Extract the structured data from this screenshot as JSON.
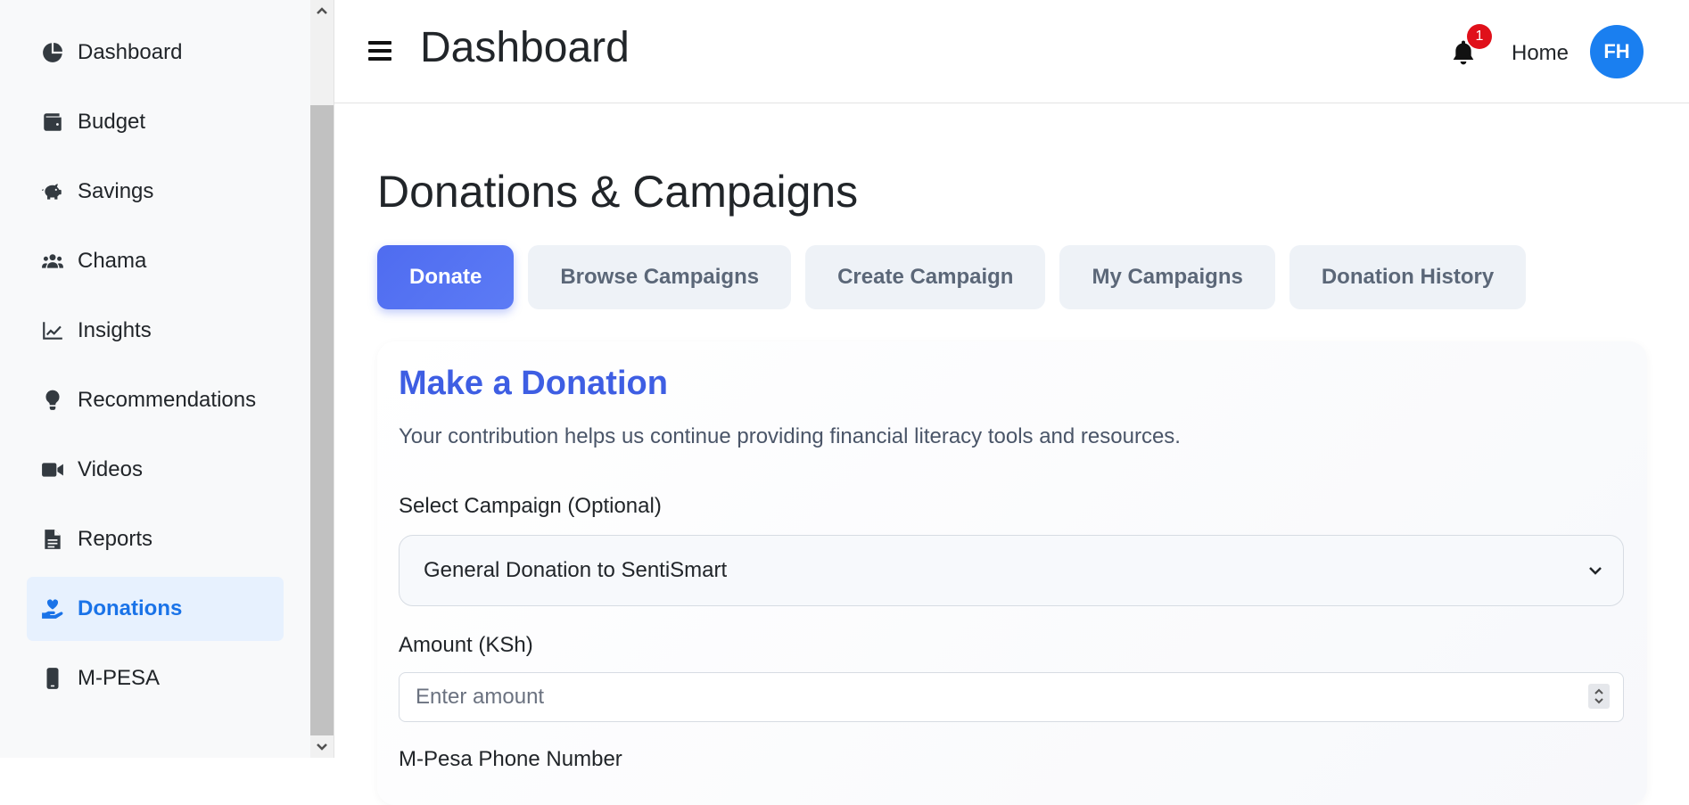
{
  "sidebar": {
    "items": [
      {
        "label": "Dashboard",
        "icon": "chart-pie-icon"
      },
      {
        "label": "Budget",
        "icon": "wallet-icon"
      },
      {
        "label": "Savings",
        "icon": "piggy-bank-icon"
      },
      {
        "label": "Chama",
        "icon": "users-icon"
      },
      {
        "label": "Insights",
        "icon": "chart-line-icon"
      },
      {
        "label": "Recommendations",
        "icon": "lightbulb-icon"
      },
      {
        "label": "Videos",
        "icon": "video-icon"
      },
      {
        "label": "Reports",
        "icon": "file-icon"
      },
      {
        "label": "Donations",
        "icon": "hand-holding-heart-icon",
        "active": true
      },
      {
        "label": "M-PESA",
        "icon": "mobile-icon"
      }
    ]
  },
  "header": {
    "title": "Dashboard",
    "notification_count": "1",
    "home_label": "Home",
    "avatar_initials": "FH"
  },
  "main": {
    "section_title": "Donations & Campaigns",
    "tabs": [
      {
        "label": "Donate",
        "active": true
      },
      {
        "label": "Browse Campaigns"
      },
      {
        "label": "Create Campaign"
      },
      {
        "label": "My Campaigns"
      },
      {
        "label": "Donation History"
      }
    ],
    "form": {
      "title": "Make a Donation",
      "description": "Your contribution helps us continue providing financial literacy tools and resources.",
      "campaign_label": "Select Campaign (Optional)",
      "campaign_value": "General Donation to SentiSmart",
      "amount_label": "Amount (KSh)",
      "amount_placeholder": "Enter amount",
      "phone_label": "M-Pesa Phone Number"
    }
  },
  "colors": {
    "accent": "#1a73e8",
    "tab_active": "#4f6cf0",
    "card_title": "#3e5ee3",
    "badge": "#e0101a",
    "avatar": "#1a7ff0"
  }
}
